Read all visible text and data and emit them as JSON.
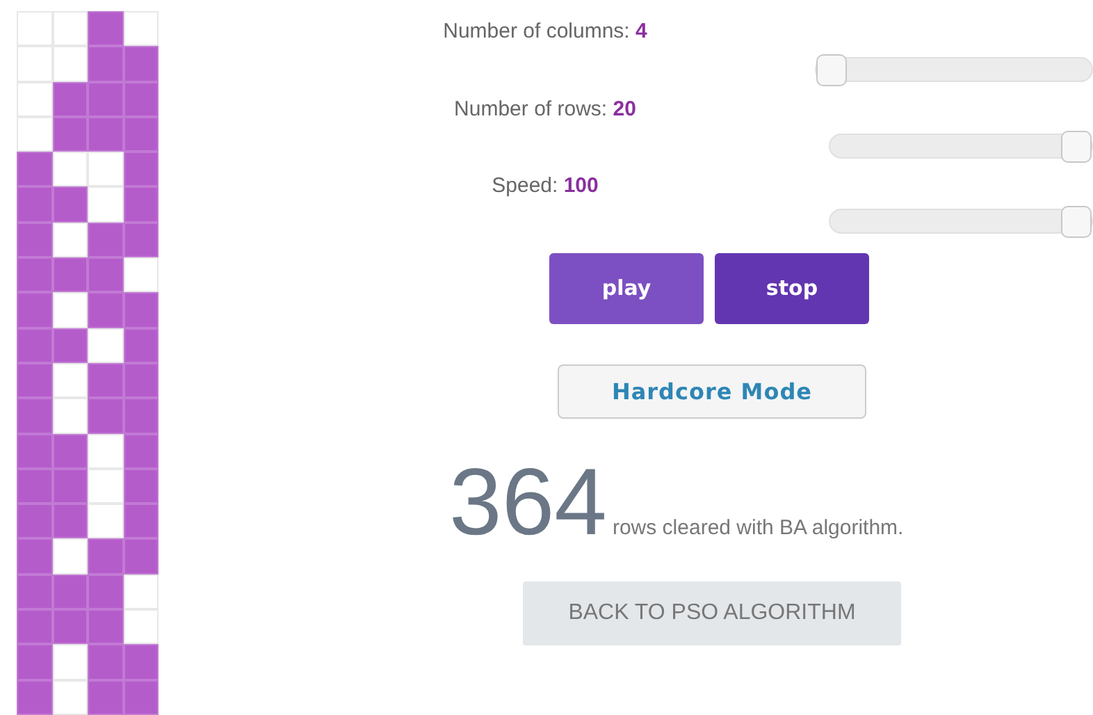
{
  "board": {
    "rows": [
      {
        "filled": [
          false,
          false,
          true,
          false
        ]
      },
      {
        "filled": [
          false,
          false,
          true,
          true
        ]
      },
      {
        "filled": [
          false,
          true,
          true,
          true
        ]
      },
      {
        "filled": [
          false,
          true,
          true,
          true
        ]
      },
      {
        "filled": [
          true,
          false,
          false,
          true
        ]
      },
      {
        "filled": [
          true,
          true,
          false,
          true
        ]
      },
      {
        "filled": [
          true,
          false,
          true,
          true
        ]
      },
      {
        "filled": [
          true,
          true,
          true,
          false
        ]
      },
      {
        "filled": [
          true,
          false,
          true,
          true
        ]
      },
      {
        "filled": [
          true,
          true,
          false,
          true
        ]
      },
      {
        "filled": [
          true,
          false,
          true,
          true
        ]
      },
      {
        "filled": [
          true,
          false,
          true,
          true
        ]
      },
      {
        "filled": [
          true,
          true,
          false,
          true
        ]
      },
      {
        "filled": [
          true,
          true,
          false,
          true
        ]
      },
      {
        "filled": [
          true,
          true,
          false,
          true
        ]
      },
      {
        "filled": [
          true,
          false,
          true,
          true
        ]
      },
      {
        "filled": [
          true,
          true,
          true,
          false
        ]
      },
      {
        "filled": [
          true,
          true,
          true,
          false
        ]
      },
      {
        "filled": [
          true,
          false,
          true,
          true
        ]
      },
      {
        "filled": [
          true,
          false,
          true,
          true
        ]
      }
    ]
  },
  "settings": [
    {
      "label": "Number of columns:",
      "value": "4",
      "level": 0
    },
    {
      "label": "Number of rows:",
      "value": "20",
      "level": 1
    },
    {
      "label": "Speed:",
      "value": "100",
      "level": 1
    }
  ],
  "buttons": [
    {
      "label": "play",
      "selected": false
    },
    {
      "label": "stop",
      "selected": true
    }
  ],
  "hardcore_button": {
    "label": "Hardcore Mode"
  },
  "score": {
    "count": "364",
    "text": "rows cleared with BA algorithm."
  },
  "back_button": {
    "label": "BACK TO PSO ALGORITHM"
  }
}
